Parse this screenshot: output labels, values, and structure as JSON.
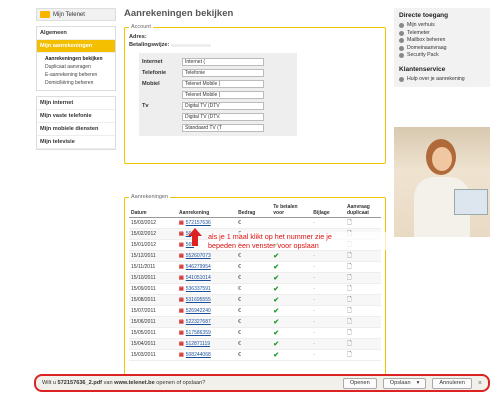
{
  "nav": {
    "logo_label": "Mijn Telenet",
    "items": [
      {
        "label": "Algemeen",
        "active": false
      },
      {
        "label": "Mijn aanrekeningen",
        "active": true
      }
    ],
    "subitems": [
      "Aanrekeningen bekijken",
      "Duplicaat aanvragen",
      "E-aanrekening beheren",
      "Domiciliëring beheren"
    ],
    "items_after": [
      "Mijn internet",
      "Mijn vaste telefonie",
      "Mijn mobiele diensten",
      "Mijn televisie"
    ]
  },
  "page": {
    "title": "Aanrekeningen bekijken"
  },
  "account": {
    "legend": "Account",
    "adres_label": "Adres:",
    "betalingswijze_label": "Betalingswijze:",
    "rows": [
      {
        "label": "Internet",
        "fields": [
          "Internet ("
        ]
      },
      {
        "label": "Telefonie",
        "fields": [
          "Telefonie"
        ]
      },
      {
        "label": "Mobiel",
        "fields": [
          "Telenet Mobile (",
          "Telenet Mobile ("
        ]
      },
      {
        "label": "Tv",
        "fields": [
          "Digital TV (DTV",
          "Digital TV (DTV.",
          "Standaard TV (T"
        ]
      }
    ]
  },
  "invoices": {
    "legend": "Aanrekeningen",
    "headers": [
      "Datum",
      "Aanrekening",
      "Bedrag",
      "Te betalen voor",
      "Bijlage",
      "Aanvraag duplicaat"
    ],
    "currency": "€",
    "rows": [
      {
        "date": "15/03/2012",
        "number": "572157636",
        "paid": false
      },
      {
        "date": "15/02/2012",
        "number": "56",
        "paid": false
      },
      {
        "date": "15/01/2012",
        "number": "569",
        "paid": true
      },
      {
        "date": "15/12/2011",
        "number": "552607073",
        "paid": true
      },
      {
        "date": "15/11/2011",
        "number": "546279954",
        "paid": true
      },
      {
        "date": "15/10/2011",
        "number": "541051014",
        "paid": true
      },
      {
        "date": "15/09/2011",
        "number": "536337591",
        "paid": true
      },
      {
        "date": "15/08/2011",
        "number": "531695555",
        "paid": true
      },
      {
        "date": "15/07/2011",
        "number": "526942240",
        "paid": true
      },
      {
        "date": "15/06/2011",
        "number": "522327687",
        "paid": true
      },
      {
        "date": "15/05/2011",
        "number": "517586359",
        "paid": true
      },
      {
        "date": "15/04/2011",
        "number": "512871119",
        "paid": true
      },
      {
        "date": "15/03/2011",
        "number": "508244068",
        "paid": true
      }
    ]
  },
  "annotation": {
    "line1": "als je 1 maal klikt op het nummer zie je",
    "line2": "bepeden een venster voor opslaan"
  },
  "right": {
    "directe_title": "Directe toegang",
    "directe_links": [
      "Mijn verhuis",
      "Telemeter",
      "Mailbox beheren",
      "Domeinaanvraag",
      "Security Pack"
    ],
    "klanten_title": "Klantenservice",
    "klanten_links": [
      "Hulp over je aanrekening"
    ]
  },
  "download_bar": {
    "prefix": "Wilt u ",
    "filename": "572157636_2.pdf",
    "middle": " van ",
    "site": "www.telenet.be",
    "suffix": " openen of opslaan?",
    "open_label": "Openen",
    "save_label": "Opslaan",
    "cancel_label": "Annuleren"
  },
  "colors": {
    "accent": "#f4bf00",
    "link": "#1a4f9c",
    "check": "#1f9c2a",
    "highlight": "#dd2222"
  }
}
